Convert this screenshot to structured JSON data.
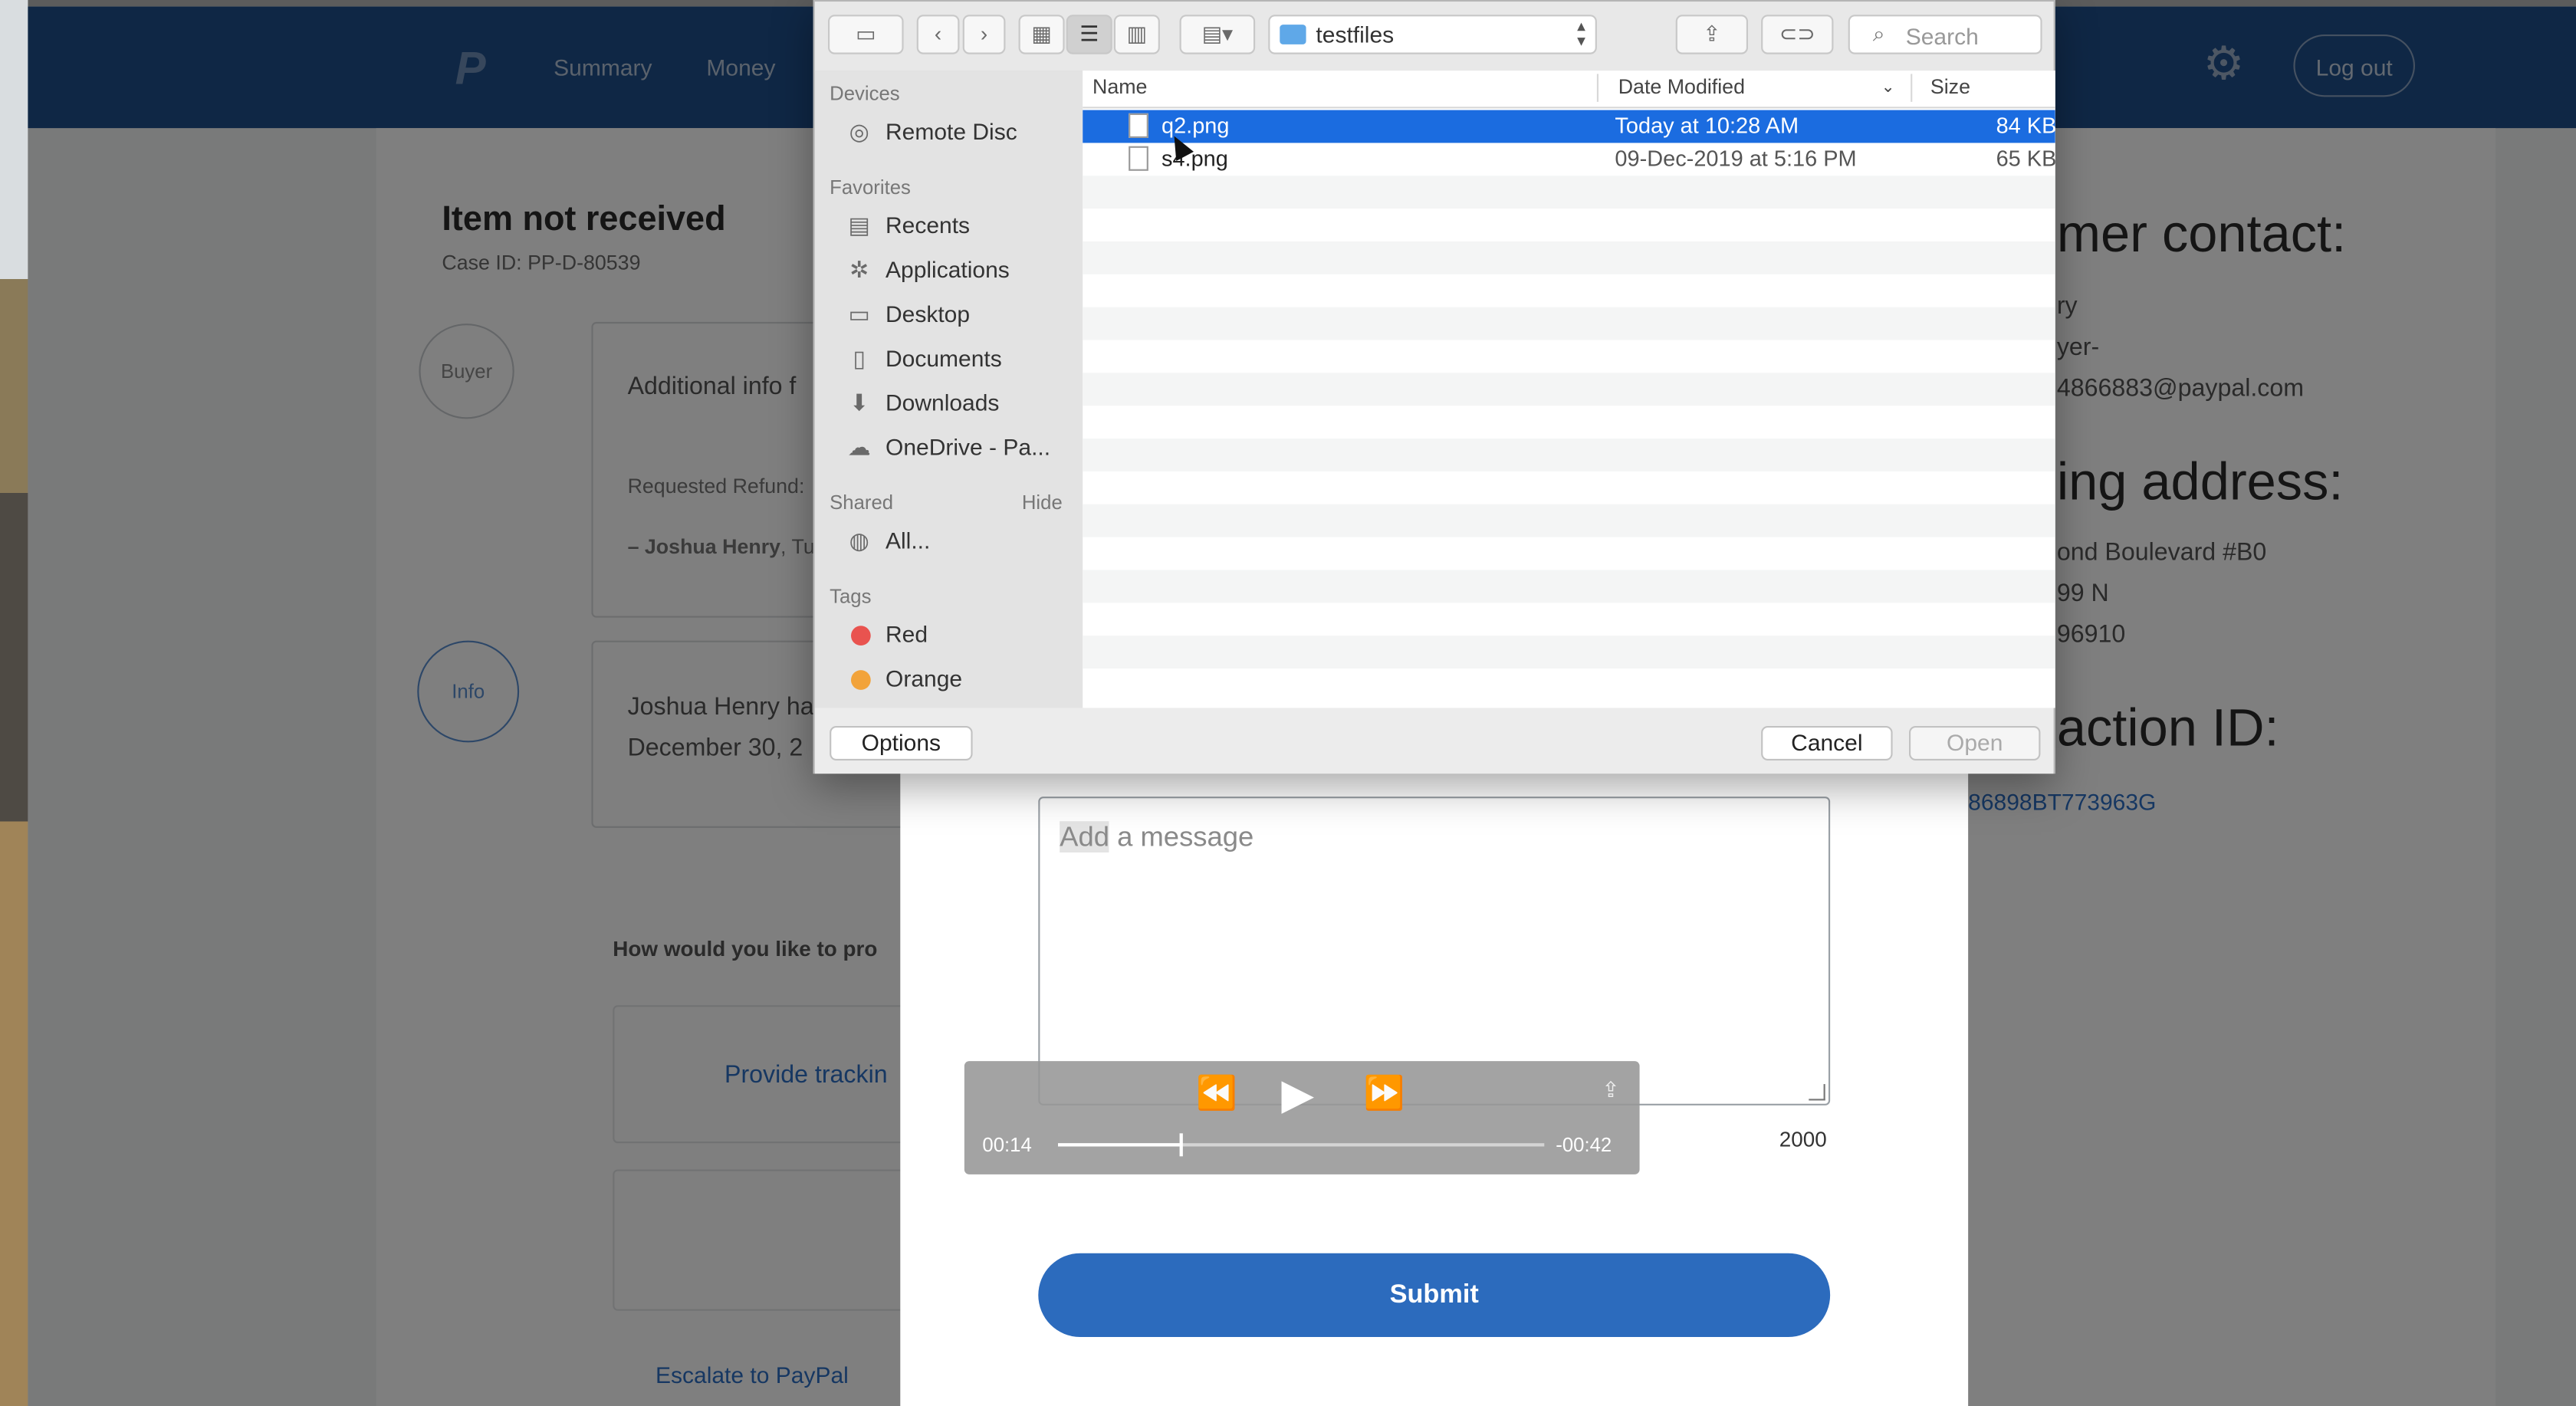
{
  "page": {
    "nav": {
      "links": [
        "Summary",
        "Money"
      ],
      "logout": "Log out"
    },
    "case": {
      "title": "Item not received",
      "case_id": "Case ID: PP-D-80539"
    },
    "timeline": {
      "buyer_label": "Buyer",
      "info_label": "Info",
      "buyer_text": "Additional info f",
      "requested": "Requested Refund:",
      "author": "– Joshua Henry",
      "author_suffix": ", Tu",
      "info_line1": "Joshua Henry ha",
      "info_line2": "December 30, 2"
    },
    "how": "How would you like to pro",
    "tracking": "Provide trackin",
    "escalate": "Escalate to PayPal",
    "right": {
      "contact_heading": "mer contact:",
      "contact_l1": "ry",
      "contact_l2": "yer-",
      "contact_l3": "4866883@paypal.com",
      "shipping_heading": "ing address:",
      "addr_l1": "ond Boulevard #B0",
      "addr_l2": "99 N",
      "addr_l3": "96910",
      "txn_heading": "action ID:",
      "txn_id": "86898BT773963G"
    }
  },
  "message_modal": {
    "placeholder_hl": "Add",
    "placeholder_rest": " a message",
    "char_count": "2000",
    "submit": "Submit"
  },
  "video": {
    "elapsed": "00:14",
    "remaining": "-00:42",
    "progress": 0.25
  },
  "dialog": {
    "folder": "testfiles",
    "search_placeholder": "Search",
    "sidebar": {
      "devices_header": "Devices",
      "devices": [
        "Remote Disc"
      ],
      "favorites_header": "Favorites",
      "favorites": [
        "Recents",
        "Applications",
        "Desktop",
        "Documents",
        "Downloads",
        "OneDrive - Pa..."
      ],
      "shared_header": "Shared",
      "shared_hide": "Hide",
      "shared": [
        "All..."
      ],
      "tags_header": "Tags",
      "tags": [
        {
          "name": "Red",
          "color": "#e9534f"
        },
        {
          "name": "Orange",
          "color": "#f2a33a"
        }
      ]
    },
    "columns": [
      "Name",
      "Date Modified",
      "Size"
    ],
    "files": [
      {
        "name": "q2.png",
        "modified": "Today at 10:28 AM",
        "size": "84 KB",
        "selected": true
      },
      {
        "name": "s4.png",
        "modified": "09-Dec-2019 at 5:16 PM",
        "size": "65 KB",
        "selected": false
      }
    ],
    "options": "Options",
    "cancel": "Cancel",
    "open": "Open"
  },
  "colors": {
    "accent": "#2c6bbd",
    "selection": "#1b6ce0",
    "nav": "#1f4f8a"
  }
}
